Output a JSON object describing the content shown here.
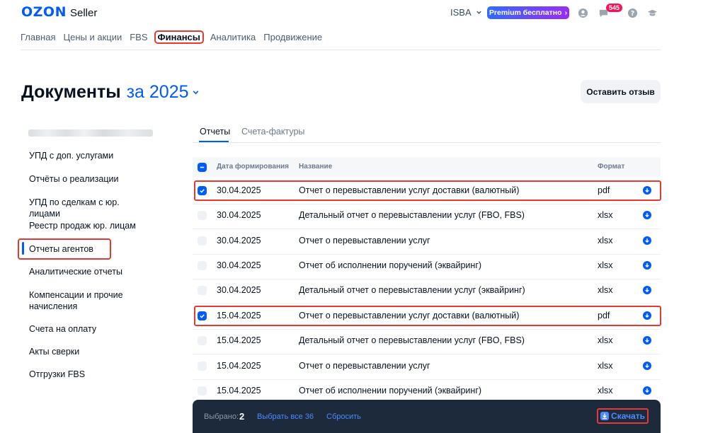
{
  "header": {
    "logo": "OZON",
    "logo_sub": "Seller",
    "org_name": "ISBA",
    "premium_label": "Premium бесплатно",
    "messages_count": "545"
  },
  "topnav": [
    "Главная",
    "Цены и акции",
    "FBS",
    "Финансы",
    "Аналитика",
    "Продвижение"
  ],
  "page": {
    "title": "Документы",
    "period": "за 2025",
    "review_button": "Оставить отзыв"
  },
  "sidebar": {
    "items": [
      "УПД с доп. услугами",
      "Отчёты о реализации",
      "УПД по сделкам с юр. лицами",
      "Реестр продаж юр. лицам",
      "Отчеты агентов",
      "Аналитические отчеты",
      "Компенсации и прочие начисления",
      "Счета на оплату",
      "Акты сверки",
      "Отгрузки FBS"
    ],
    "active_index": 4
  },
  "tabs": [
    "Отчеты",
    "Счета-фактуры"
  ],
  "table": {
    "columns": [
      "Дата формирования",
      "Название",
      "Формат"
    ],
    "rows": [
      {
        "date": "30.04.2025",
        "name": "Отчет о перевыставлении услуг доставки (валютный)",
        "format": "pdf",
        "checked": true
      },
      {
        "date": "30.04.2025",
        "name": "Детальный отчет о перевыставлении услуг (FBO, FBS)",
        "format": "xlsx",
        "checked": false
      },
      {
        "date": "30.04.2025",
        "name": "Отчет о перевыставлении услуг",
        "format": "xlsx",
        "checked": false
      },
      {
        "date": "30.04.2025",
        "name": "Отчет об исполнении поручений (эквайринг)",
        "format": "xlsx",
        "checked": false
      },
      {
        "date": "30.04.2025",
        "name": "Детальный отчет о перевыставлении услуг (эквайринг)",
        "format": "xlsx",
        "checked": false
      },
      {
        "date": "15.04.2025",
        "name": "Отчет о перевыставлении услуг доставки (валютный)",
        "format": "pdf",
        "checked": true
      },
      {
        "date": "15.04.2025",
        "name": "Детальный отчет о перевыставлении услуг (FBO, FBS)",
        "format": "xlsx",
        "checked": false
      },
      {
        "date": "15.04.2025",
        "name": "Отчет о перевыставлении услуг",
        "format": "xlsx",
        "checked": false
      },
      {
        "date": "15.04.2025",
        "name": "Отчет об исполнении поручений (эквайринг)",
        "format": "xlsx",
        "checked": false
      }
    ]
  },
  "bottombar": {
    "selected_label": "Выбрано:",
    "selected_count": "2",
    "select_all": "Выбрать все 36",
    "reset": "Сбросить",
    "download": "Скачать"
  },
  "colors": {
    "accent": "#005bff",
    "highlight": "#e53935",
    "bar_bg": "#1d2a3c"
  }
}
